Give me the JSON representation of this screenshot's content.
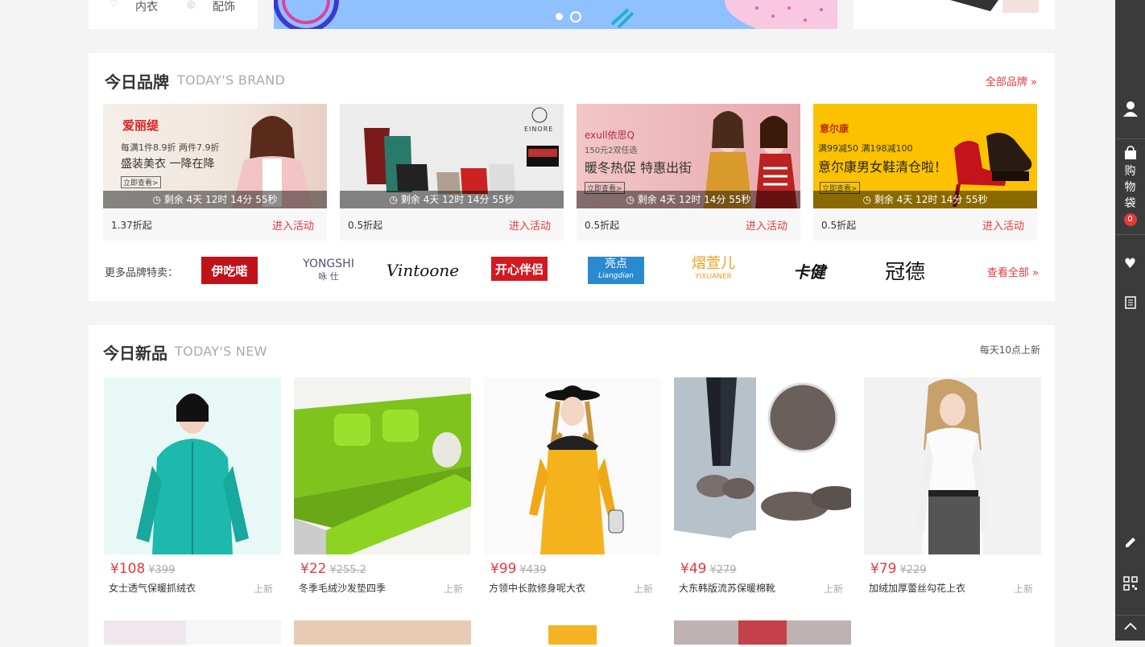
{
  "top": {
    "categories": [
      {
        "label": "内衣",
        "icon": "underwear-icon"
      },
      {
        "label": "配饰",
        "icon": "accessory-icon"
      }
    ]
  },
  "brand": {
    "title": "今日品牌",
    "subtitle": "TODAY'S BRAND",
    "all_link": "全部品牌 »",
    "cards": [
      {
        "name": "爱丽缇",
        "promo": "每满1件8.9折 两件7.9折",
        "headline": "盛装美衣 一降在降",
        "cta": "立即查看>",
        "timer": "剩余 4天 12时 14分 55秒",
        "discount": "1.37折起",
        "enter": "进入活动"
      },
      {
        "name": "EINORE",
        "promo": "",
        "headline": "",
        "cta": "",
        "timer": "剩余 4天 12时 14分 55秒",
        "discount": "0.5折起",
        "enter": "进入活动"
      },
      {
        "name": "exull依思Q",
        "promo": "150元2双任选",
        "headline": "暖冬热促 特惠出街",
        "cta": "立即查看>",
        "timer": "剩余 4天 12时 14分 55秒",
        "discount": "0.5折起",
        "enter": "进入活动"
      },
      {
        "name": "意尔康",
        "promo": "满99减50 满198减100",
        "headline": "意尔康男女鞋清仓啦！",
        "cta": "立即查看>",
        "timer": "剩余 4天 12时 14分 55秒",
        "discount": "0.5折起",
        "enter": "进入活动"
      }
    ],
    "more_label": "更多品牌特卖：",
    "logos": [
      "伊吃喏",
      "YONGSHI",
      "Vintoone",
      "开心伴侣",
      "亮点",
      "熠萱儿",
      "卡健",
      "冠德"
    ],
    "logo_yongshi_cn": "咏 仕",
    "logo_yixuaner_en": "YIXUANER",
    "logo_liangdian_en": "Liangdian",
    "view_all": "查看全部 »"
  },
  "newsec": {
    "title": "今日新品",
    "subtitle": "TODAY'S NEW",
    "note": "每天10点上新",
    "products": [
      {
        "price": "¥108",
        "old": "¥399",
        "name": "女士透气保暖抓绒衣",
        "tag": "上新"
      },
      {
        "price": "¥22",
        "old": "¥255.2",
        "name": "冬季毛绒沙发垫四季",
        "tag": "上新"
      },
      {
        "price": "¥99",
        "old": "¥439",
        "name": "方领中长款修身呢大衣",
        "tag": "上新"
      },
      {
        "price": "¥49",
        "old": "¥279",
        "name": "大东韩版流苏保暖棉靴",
        "tag": "上新"
      },
      {
        "price": "¥79",
        "old": "¥229",
        "name": "加绒加厚蕾丝勾花上衣",
        "tag": "上新"
      }
    ]
  },
  "sidebar": {
    "cart_label": "购物袋",
    "cart_count": "0",
    "icons": [
      "user-icon",
      "shopping-bag-icon",
      "heart-icon",
      "history-icon",
      "edit-icon",
      "qrcode-icon",
      "back-to-top-icon"
    ]
  },
  "colors": {
    "accent": "#e4393c",
    "sidebar": "#3b3b3b"
  }
}
